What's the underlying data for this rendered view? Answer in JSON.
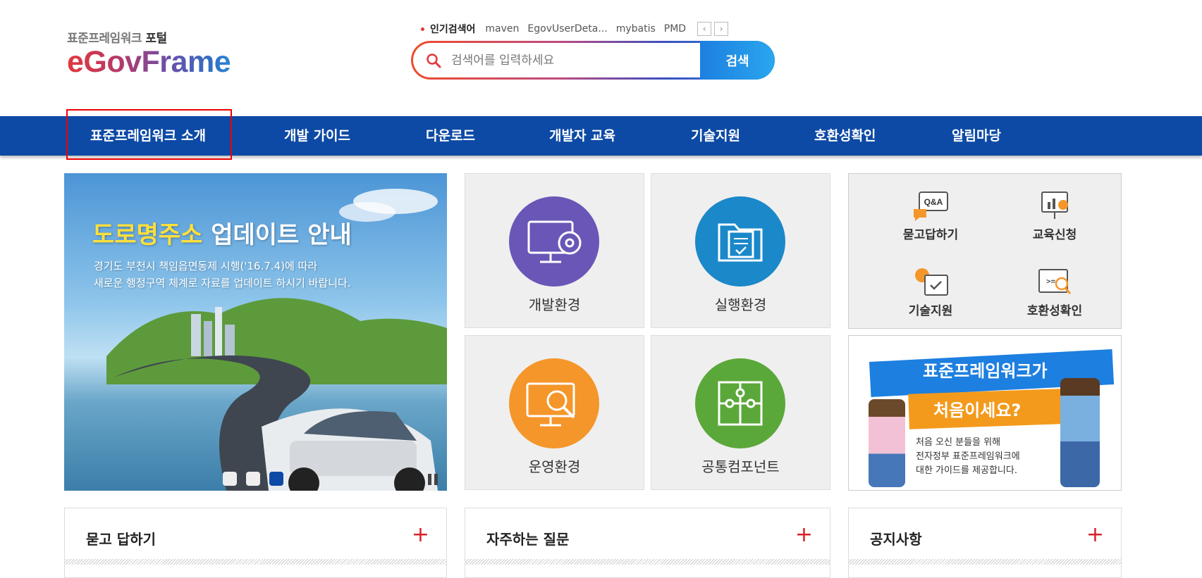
{
  "logo": {
    "subtitle_prefix": "표준프레임워크",
    "subtitle_suffix": "포털",
    "brand": "eGovFrame"
  },
  "popular": {
    "label": "인기검색어",
    "keywords": [
      "maven",
      "EgovUserDeta...",
      "mybatis",
      "PMD"
    ]
  },
  "search": {
    "placeholder": "검색어를 입력하세요",
    "button": "검색"
  },
  "nav": {
    "items": [
      "표준프레임워크 소개",
      "개발 가이드",
      "다운로드",
      "개발자 교육",
      "기술지원",
      "호환성확인",
      "알림마당"
    ]
  },
  "banner": {
    "title_highlight": "도로명주소",
    "title_rest": "업데이트 안내",
    "desc_line1": "경기도 부천시 책임읍면동제 시행('16.7.4)에 따라",
    "desc_line2": "새로운 행정구역 체계로 자료를 업데이트 하시기 바랍니다.",
    "slides": 3,
    "active_slide": 3
  },
  "tiles": [
    {
      "label": "개발환경",
      "icon": "monitor-gear-icon",
      "color": "#6a56b7"
    },
    {
      "label": "실행환경",
      "icon": "folder-doc-icon",
      "color": "#1a88c9"
    },
    {
      "label": "운영환경",
      "icon": "monitor-search-icon",
      "color": "#f5962a"
    },
    {
      "label": "공통컴포넌트",
      "icon": "puzzle-icon",
      "color": "#5ba83a"
    }
  ],
  "quick": [
    {
      "label": "묻고답하기",
      "icon": "qna-icon"
    },
    {
      "label": "교육신청",
      "icon": "presentation-icon"
    },
    {
      "label": "기술지원",
      "icon": "gear-check-icon"
    },
    {
      "label": "호환성확인",
      "icon": "code-search-icon"
    }
  ],
  "promo": {
    "line1": "표준프레임워크가",
    "line2": "처음이세요?",
    "desc1": "처음 오신 분들을 위해",
    "desc2": "전자정부 표준프레임워크에",
    "desc3": "대한 가이드를 제공합니다."
  },
  "boards": [
    {
      "title": "묻고 답하기",
      "plus": "+"
    },
    {
      "title": "자주하는 질문",
      "plus": "+"
    },
    {
      "title": "공지사항",
      "plus": "+"
    }
  ]
}
